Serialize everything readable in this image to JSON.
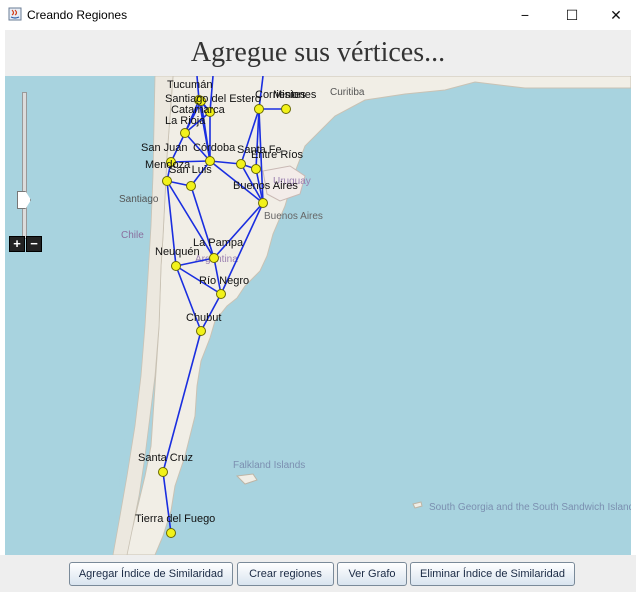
{
  "window": {
    "title": "Creando Regiones",
    "minimize": "−",
    "maximize": "☐",
    "close": "✕"
  },
  "heading": "Agregue sus vértices...",
  "map": {
    "geo_labels": [
      "Curitiba",
      "Uruguay",
      "Buenos Aires",
      "Chile",
      "Argentina",
      "Santiago",
      "Falkland Islands",
      "South Georgia and the South Sandwich Islands"
    ],
    "vertices": [
      {
        "name": "Tucumán"
      },
      {
        "name": "Santiago del Estero"
      },
      {
        "name": "Catamarca"
      },
      {
        "name": "La Rioja"
      },
      {
        "name": "Corrientes"
      },
      {
        "name": "Misiones"
      },
      {
        "name": "San Juan"
      },
      {
        "name": "Córdoba"
      },
      {
        "name": "Santa Fe"
      },
      {
        "name": "Entre Ríos"
      },
      {
        "name": "Mendoza"
      },
      {
        "name": "San Luis"
      },
      {
        "name": "Buenos Aires"
      },
      {
        "name": "La Pampa"
      },
      {
        "name": "Neuquén"
      },
      {
        "name": "Río Negro"
      },
      {
        "name": "Chubut"
      },
      {
        "name": "Santa Cruz"
      },
      {
        "name": "Tierra del Fuego"
      }
    ]
  },
  "zoom": {
    "plus": "+",
    "minus": "−"
  },
  "buttons": {
    "add_similarity": "Agregar Índice de Similaridad",
    "create_regions": "Crear regiones",
    "view_graph": "Ver Grafo",
    "remove_similarity": "Eliminar Índice de Similaridad"
  },
  "colors": {
    "edge": "#1a2ee0",
    "vertex": "#f2f21a",
    "sea": "#a8d3df",
    "land": "#f1eee6"
  }
}
